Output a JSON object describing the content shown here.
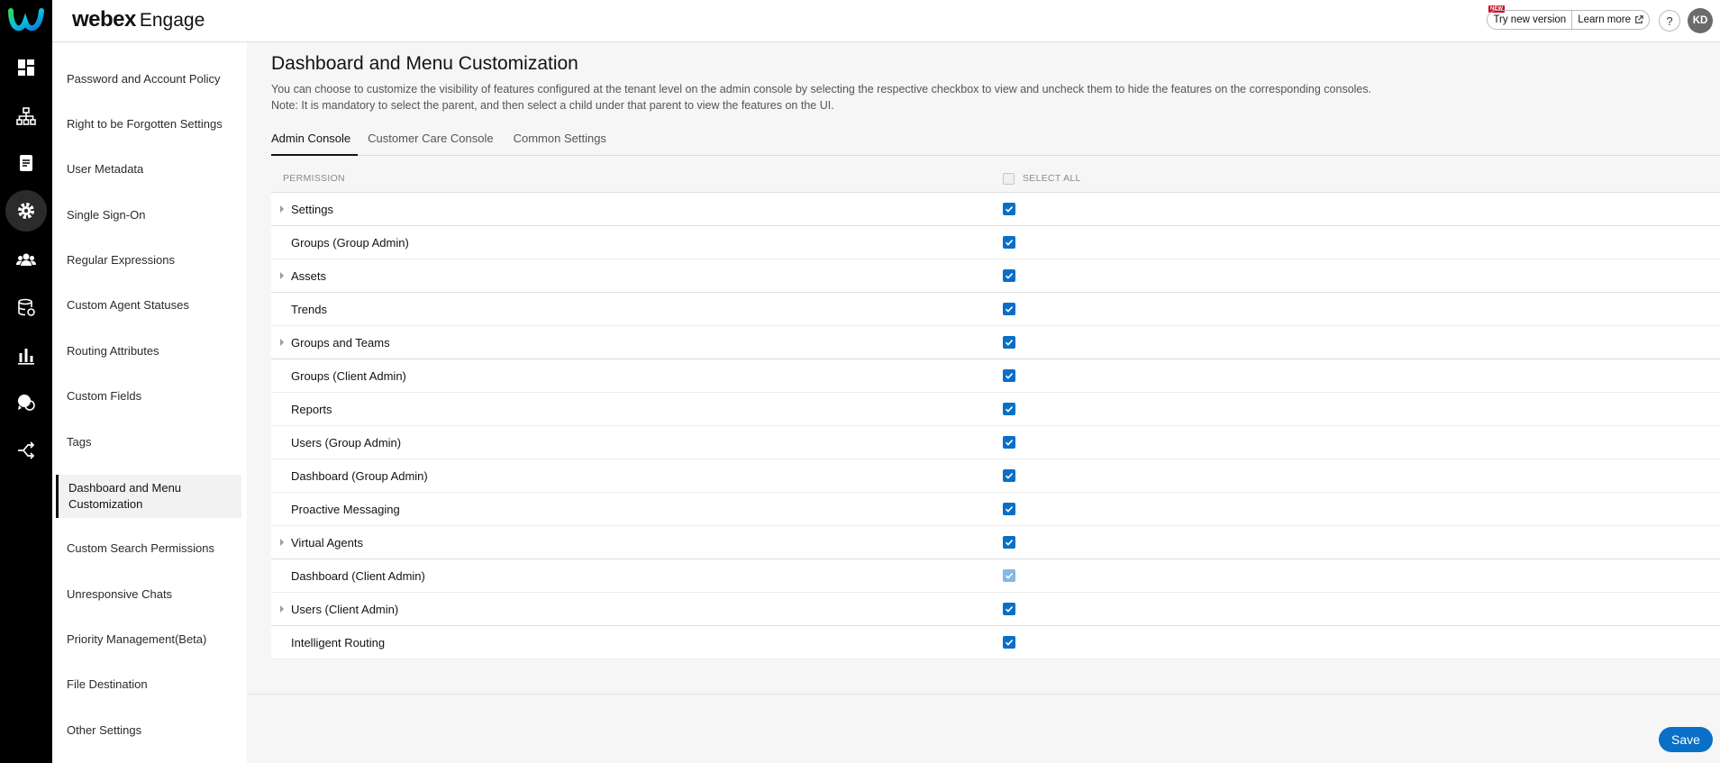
{
  "brand": {
    "name": "webex",
    "product": "Engage"
  },
  "header": {
    "new_badge": "NEW",
    "try_new_version": "Try new version",
    "learn_more": "Learn more",
    "help": "?",
    "avatar_initials": "KD"
  },
  "rail": {
    "icons": [
      "dashboard-icon",
      "org-chart-icon",
      "document-icon",
      "gear-icon",
      "people-icon",
      "database-icon",
      "bar-chart-icon",
      "chat-bubbles-icon",
      "routing-icon"
    ],
    "active": "gear-icon"
  },
  "sidebar": {
    "items": [
      {
        "label": "Password and Account Policy"
      },
      {
        "label": "Right to be Forgotten Settings"
      },
      {
        "label": "User Metadata"
      },
      {
        "label": "Single Sign-On"
      },
      {
        "label": "Regular Expressions"
      },
      {
        "label": "Custom Agent Statuses"
      },
      {
        "label": "Routing Attributes"
      },
      {
        "label": "Custom Fields"
      },
      {
        "label": "Tags"
      },
      {
        "label": "Dashboard and Menu Customization"
      },
      {
        "label": "Custom Search Permissions"
      },
      {
        "label": "Unresponsive Chats"
      },
      {
        "label": "Priority Management(Beta)"
      },
      {
        "label": "File Destination"
      },
      {
        "label": "Other Settings"
      }
    ],
    "active_index": 9
  },
  "main": {
    "title": "Dashboard and Menu Customization",
    "description_1": "You can choose to customize the visibility of features configured at the tenant level on the admin console by selecting the respective checkbox to view and uncheck them to hide the features on the corresponding consoles.",
    "description_2": "Note: It is mandatory to select the parent, and then select a child under that parent to view the features on the UI.",
    "tabs": [
      {
        "label": "Admin Console",
        "active": true
      },
      {
        "label": "Customer Care Console",
        "active": false
      },
      {
        "label": "Common Settings",
        "active": false
      }
    ],
    "table": {
      "col_permission": "PERMISSION",
      "select_all": "SELECT ALL",
      "rows": [
        {
          "label": "Settings",
          "expandable": true,
          "checked": true,
          "disabled": false
        },
        {
          "label": "Groups (Group Admin)",
          "expandable": false,
          "checked": true,
          "disabled": false
        },
        {
          "label": "Assets",
          "expandable": true,
          "checked": true,
          "disabled": false
        },
        {
          "label": "Trends",
          "expandable": false,
          "checked": true,
          "disabled": false
        },
        {
          "label": "Groups and Teams",
          "expandable": true,
          "checked": true,
          "disabled": false
        },
        {
          "label": "Groups (Client Admin)",
          "expandable": false,
          "checked": true,
          "disabled": false
        },
        {
          "label": "Reports",
          "expandable": false,
          "checked": true,
          "disabled": false
        },
        {
          "label": "Users (Group Admin)",
          "expandable": false,
          "checked": true,
          "disabled": false
        },
        {
          "label": "Dashboard (Group Admin)",
          "expandable": false,
          "checked": true,
          "disabled": false
        },
        {
          "label": "Proactive Messaging",
          "expandable": false,
          "checked": true,
          "disabled": false
        },
        {
          "label": "Virtual Agents",
          "expandable": true,
          "checked": true,
          "disabled": false
        },
        {
          "label": "Dashboard (Client Admin)",
          "expandable": false,
          "checked": true,
          "disabled": true
        },
        {
          "label": "Users (Client Admin)",
          "expandable": true,
          "checked": true,
          "disabled": false
        },
        {
          "label": "Intelligent Routing",
          "expandable": false,
          "checked": true,
          "disabled": false
        }
      ]
    },
    "save_label": "Save"
  },
  "colors": {
    "accent": "#0a6fc6",
    "rail": "#000000"
  }
}
